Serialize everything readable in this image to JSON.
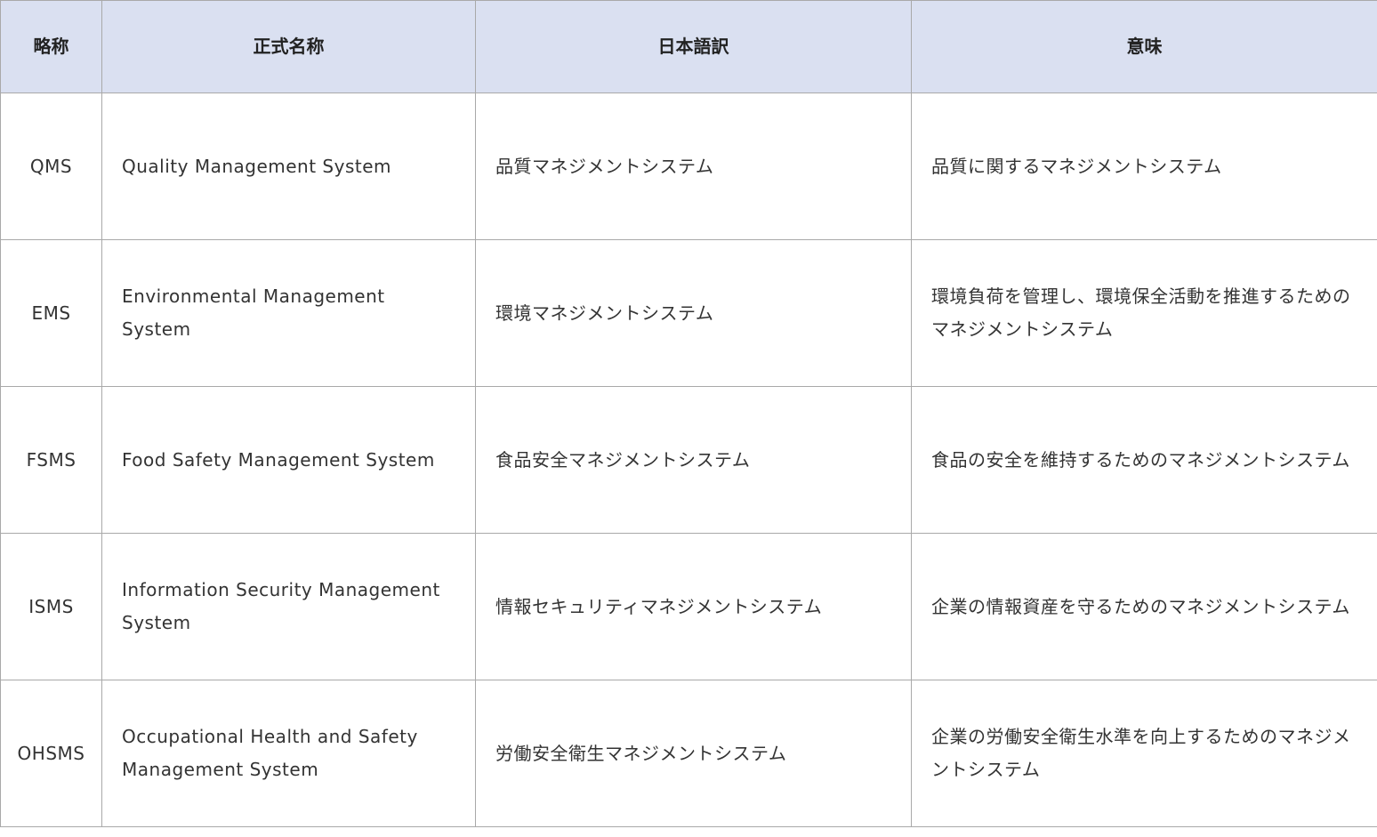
{
  "table": {
    "headers": [
      "略称",
      "正式名称",
      "日本語訳",
      "意味"
    ],
    "rows": [
      {
        "abbr": "QMS",
        "full_name": "Quality Management System",
        "japanese": "品質マネジメントシステム",
        "meaning": "品質に関するマネジメントシステム"
      },
      {
        "abbr": "EMS",
        "full_name": "Environmental Management System",
        "japanese": "環境マネジメントシステム",
        "meaning": "環境負荷を管理し、環境保全活動を推進するためのマネジメントシステム"
      },
      {
        "abbr": "FSMS",
        "full_name": "Food Safety Management System",
        "japanese": "食品安全マネジメントシステム",
        "meaning": "食品の安全を維持するためのマネジメントシステム"
      },
      {
        "abbr": "ISMS",
        "full_name": "Information Security Management System",
        "japanese": "情報セキュリティマネジメントシステム",
        "meaning": "企業の情報資産を守るためのマネジメントシステム"
      },
      {
        "abbr": "OHSMS",
        "full_name": "Occupational Health and Safety Management System",
        "japanese": "労働安全衛生マネジメントシステム",
        "meaning": "企業の労働安全衛生水準を向上するためのマネジメントシステム"
      }
    ]
  },
  "colors": {
    "header_bg": "#dae0f1",
    "border": "#a9a9a9",
    "text": "#333333"
  }
}
